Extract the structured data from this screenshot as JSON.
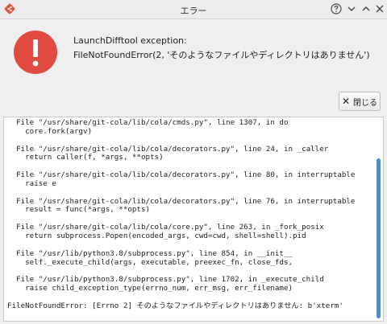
{
  "window": {
    "title": "エラー"
  },
  "message": {
    "heading": "LaunchDifftool exception:",
    "detail": "FileNotFoundError(2, 'そのようなファイルやディレクトリはありません')"
  },
  "buttons": {
    "close_label": "閉じる"
  },
  "traceback": {
    "text": "  File \"/usr/share/git-cola/lib/cola/cmds.py\", line 1307, in do\n    core.fork(argv)\n\n  File \"/usr/share/git-cola/lib/cola/decorators.py\", line 24, in _caller\n    return caller(f, *args, **opts)\n\n  File \"/usr/share/git-cola/lib/cola/decorators.py\", line 80, in interruptable\n    raise e\n\n  File \"/usr/share/git-cola/lib/cola/decorators.py\", line 76, in interruptable\n    result = func(*args, **opts)\n\n  File \"/usr/share/git-cola/lib/cola/core.py\", line 263, in _fork_posix\n    return subprocess.Popen(encoded_args, cwd=cwd, shell=shell).pid\n\n  File \"/usr/lib/python3.8/subprocess.py\", line 854, in __init__\n    self._execute_child(args, executable, preexec_fn, close_fds,\n\n  File \"/usr/lib/python3.8/subprocess.py\", line 1702, in _execute_child\n    raise child_exception_type(errno_num, err_msg, err_filename)\n\nFileNotFoundError: [Errno 2] そのようなファイルやディレクトリはありません: b'xterm'"
  },
  "icons": {
    "app": "git-cola-icon",
    "error": "error-exclamation-icon",
    "help": "help-question-icon",
    "minimize": "minimize-icon",
    "maximize": "maximize-icon",
    "close": "close-icon"
  },
  "colors": {
    "error_red": "#e04a3f",
    "scroll_accent": "#3f8ee0",
    "app_icon": "#e2563b"
  }
}
